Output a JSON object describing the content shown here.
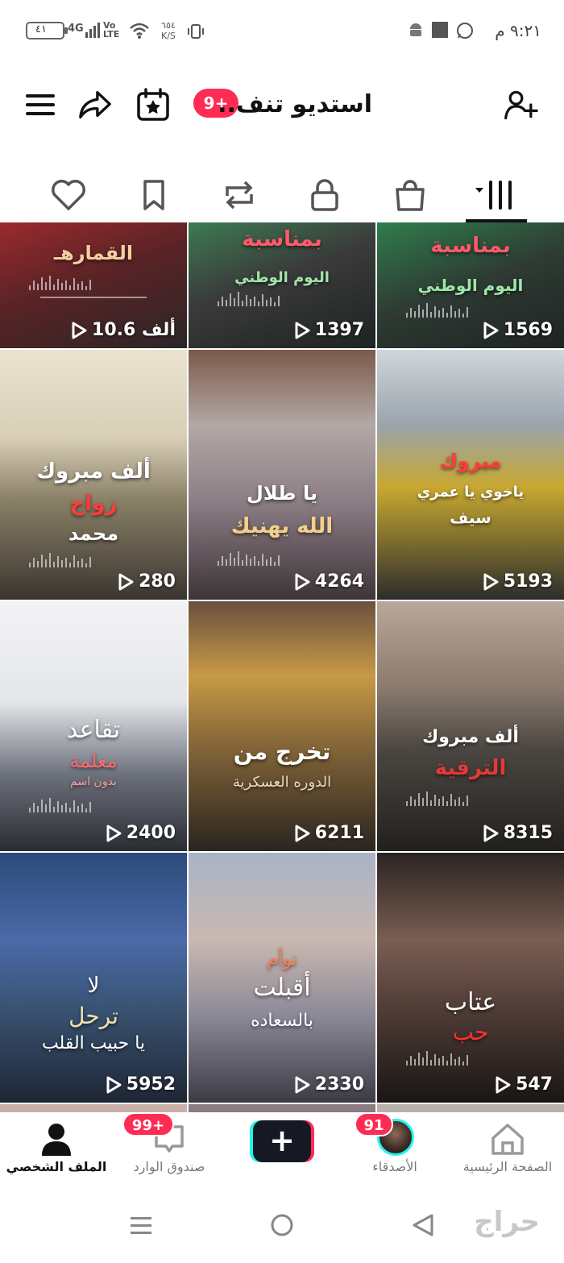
{
  "status_bar": {
    "time": "٩:٢١ م",
    "battery": "٤١",
    "network_type": "4G",
    "network_label_line1": "Vo",
    "network_label_line2": "LTE",
    "speed_value": "٦٥٤",
    "speed_unit": "K/S",
    "notification_icons": [
      "android-icon",
      "square-icon",
      "whatsapp-icon"
    ]
  },
  "header": {
    "title": "استديو تنف..",
    "notification_badge": "9+",
    "icons": [
      "menu-icon",
      "share-icon",
      "calendar-star-icon",
      "add-user-icon"
    ]
  },
  "tabs": [
    {
      "name": "liked",
      "icon": "heart-icon"
    },
    {
      "name": "saved",
      "icon": "bookmark-icon"
    },
    {
      "name": "reposts",
      "icon": "repost-icon"
    },
    {
      "name": "private",
      "icon": "lock-icon"
    },
    {
      "name": "shop",
      "icon": "bag-icon"
    },
    {
      "name": "videos",
      "icon": "grid-icon",
      "active": true
    }
  ],
  "grid": {
    "videos": [
      {
        "views": "10.6 ألف",
        "caption1": "القمارهـ",
        "caption2": ""
      },
      {
        "views": "1397",
        "caption1": "بمناسبة",
        "caption2": "اليوم الوطني"
      },
      {
        "views": "1569",
        "caption1": "بمناسبة",
        "caption2": "اليوم الوطني"
      },
      {
        "views": "280",
        "caption1": "ألف مبروك",
        "caption2": "زواج",
        "caption3": "محمد"
      },
      {
        "views": "4264",
        "caption1": "يا طلال",
        "caption2": "الله يهنيك"
      },
      {
        "views": "5193",
        "caption1": "مبروك",
        "caption2": "ياخوي يا عمري",
        "caption3": "سيف"
      },
      {
        "views": "2400",
        "caption1": "تقاعد",
        "caption2": "معلمة",
        "caption3": "بدون اسم"
      },
      {
        "views": "6211",
        "caption1": "تخرج من",
        "caption2": "الدوره العسكرية"
      },
      {
        "views": "8315",
        "caption1": "ألف مبروك",
        "caption2": "الترقية"
      },
      {
        "views": "5952",
        "caption1": "لا",
        "caption2": "ترحل",
        "caption3": "يا حبيب القلب"
      },
      {
        "views": "2330",
        "caption1": "توأم",
        "caption2": "أقبلت",
        "caption3": "بالسعاده"
      },
      {
        "views": "547",
        "caption1": "عتاب",
        "caption2": "حب"
      }
    ]
  },
  "bottom_nav": {
    "home": "الصفحة الرئيسية",
    "friends": "الأصدقاء",
    "friends_badge": "91",
    "inbox": "صندوق الوارد",
    "inbox_badge": "99+",
    "profile": "الملف الشخصي",
    "create_label": "+"
  },
  "watermark": "حراج"
}
